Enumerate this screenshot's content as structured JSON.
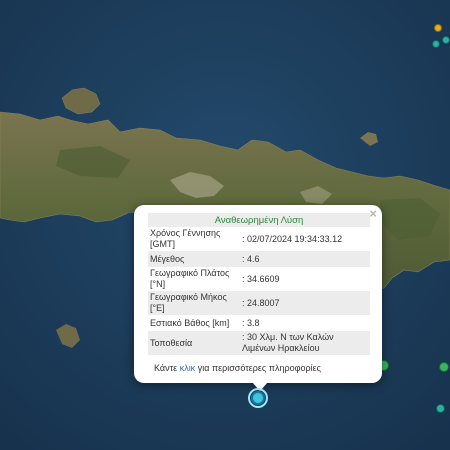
{
  "popup": {
    "title": "Αναθεωρημένη Λύση",
    "close_glyph": "×",
    "rows": [
      {
        "label": "Χρόνος Γέννησης [GMT]",
        "value": ": 02/07/2024 19:34:33.12"
      },
      {
        "label": "Μέγεθος",
        "value": ": 4.6"
      },
      {
        "label": "Γεωγραφικό Πλάτος [°N]",
        "value": ": 34.6609"
      },
      {
        "label": "Γεωγραφικό Μήκος [°E]",
        "value": ": 24.8007"
      },
      {
        "label": "Εστιακό Βάθος [km]",
        "value": ": 3.8"
      },
      {
        "label": "Τοποθεσία",
        "value": ": 30 Χλμ. Ν των Καλών Λιμένων Ηρακλείου"
      }
    ],
    "footer_prefix": "Κάντε",
    "footer_link": "κλικ",
    "footer_suffix": "για περισσότερες πληροφορίες"
  },
  "markers": [
    {
      "name": "quake-marker-selected",
      "color": "cyan"
    },
    {
      "name": "quake-marker-north-1",
      "color": "yellow"
    },
    {
      "name": "quake-marker-north-2",
      "color": "teal"
    },
    {
      "name": "quake-marker-north-3",
      "color": "teal"
    },
    {
      "name": "quake-marker-south-1",
      "color": "green"
    },
    {
      "name": "quake-marker-east-1",
      "color": "green"
    },
    {
      "name": "quake-marker-east-2",
      "color": "teal"
    }
  ],
  "colors": {
    "sea": "#1c3d5c",
    "land": "#6e6a45",
    "popup_title": "#2a8a3a",
    "link": "#2a6ebd"
  }
}
